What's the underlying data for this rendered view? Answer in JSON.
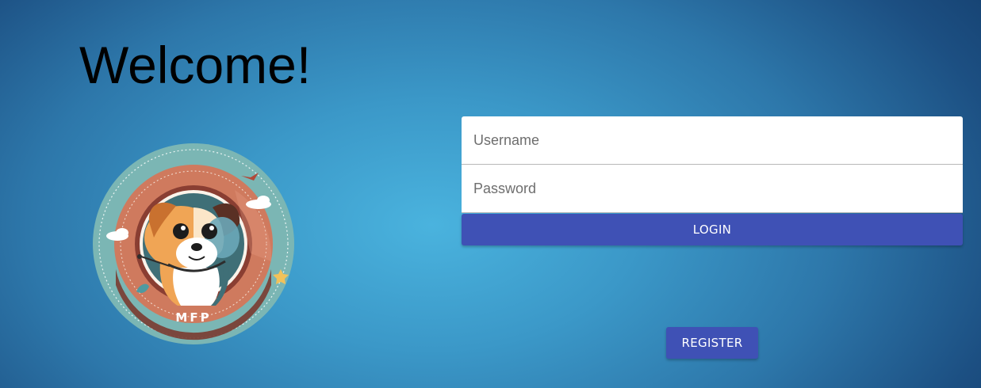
{
  "page": {
    "heading": "Welcome!",
    "background_colors": [
      "#4ab3de",
      "#2d77aa",
      "#123a68"
    ]
  },
  "logo": {
    "icon": "dog-logo-icon",
    "text": "MFP"
  },
  "login_form": {
    "username_placeholder": "Username",
    "username_value": "",
    "password_placeholder": "Password",
    "password_value": "",
    "login_label": "LOGIN"
  },
  "register": {
    "label": "REGISTER"
  },
  "colors": {
    "button": "#3f51b5",
    "field_background": "#ffffff",
    "heading_text": "#000000"
  }
}
